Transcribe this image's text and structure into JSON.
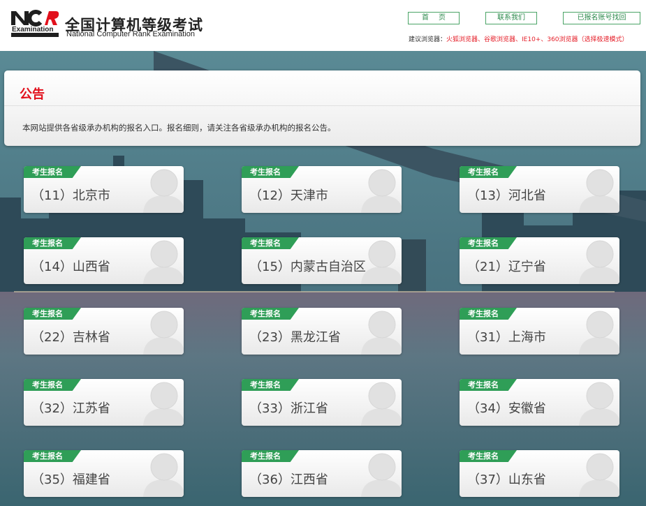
{
  "header": {
    "logo_text": "NCRE",
    "site_title": "全国计算机等级考试",
    "site_subtitle": "National Computer Rank Examination",
    "nav": {
      "home": "首页",
      "contact": "联系我们",
      "recover": "已报名账号找回"
    },
    "browser_tip_label": "建议浏览器：",
    "browser_tip_value": "火狐浏览器、谷歌浏览器、IE10+、360浏览器（选择极速模式）"
  },
  "notice": {
    "title": "公告",
    "text": "本网站提供各省级承办机构的报名入口。报名细则，请关注各省级承办机构的报名公告。"
  },
  "badge_label": "考生报名",
  "provinces": [
    {
      "code": "11",
      "name": "（11）北京市"
    },
    {
      "code": "12",
      "name": "（12）天津市"
    },
    {
      "code": "13",
      "name": "（13）河北省"
    },
    {
      "code": "14",
      "name": "（14）山西省"
    },
    {
      "code": "15",
      "name": "（15）内蒙古自治区"
    },
    {
      "code": "21",
      "name": "（21）辽宁省"
    },
    {
      "code": "22",
      "name": "（22）吉林省"
    },
    {
      "code": "23",
      "name": "（23）黑龙江省"
    },
    {
      "code": "31",
      "name": "（31）上海市"
    },
    {
      "code": "32",
      "name": "（32）江苏省"
    },
    {
      "code": "33",
      "name": "（33）浙江省"
    },
    {
      "code": "34",
      "name": "（34）安徽省"
    },
    {
      "code": "35",
      "name": "（35）福建省"
    },
    {
      "code": "36",
      "name": "（36）江西省"
    },
    {
      "code": "37",
      "name": "（37）山东省"
    }
  ],
  "colors": {
    "accent_green": "#2f9e57",
    "notice_red": "#e2101c",
    "tip_red": "#e5212b"
  }
}
